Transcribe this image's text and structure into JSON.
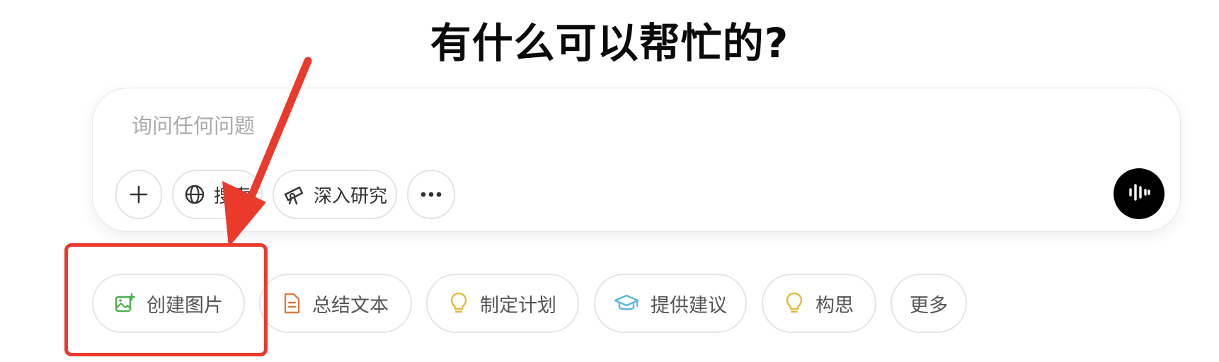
{
  "heading": "有什么可以帮忙的?",
  "composer": {
    "placeholder": "询问任何问题",
    "add_icon": "plus-icon",
    "search_label": "搜索",
    "search_icon": "globe-icon",
    "deep_research_label": "深入研究",
    "deep_research_icon": "telescope-icon",
    "more_icon": "ellipsis-icon",
    "voice_icon": "voice-waveform-icon"
  },
  "suggestions": [
    {
      "label": "创建图片",
      "icon": "image-plus-icon",
      "color": "#4caf50"
    },
    {
      "label": "总结文本",
      "icon": "document-icon",
      "color": "#e07a3e"
    },
    {
      "label": "制定计划",
      "icon": "lightbulb-icon",
      "color": "#e2b93b"
    },
    {
      "label": "提供建议",
      "icon": "graduation-cap-icon",
      "color": "#57b8e0"
    },
    {
      "label": "构思",
      "icon": "lightbulb-icon",
      "color": "#e2b93b"
    },
    {
      "label": "更多",
      "icon": "",
      "color": ""
    }
  ],
  "annotation": {
    "color": "#ea3a2c",
    "target": "创建图片"
  }
}
